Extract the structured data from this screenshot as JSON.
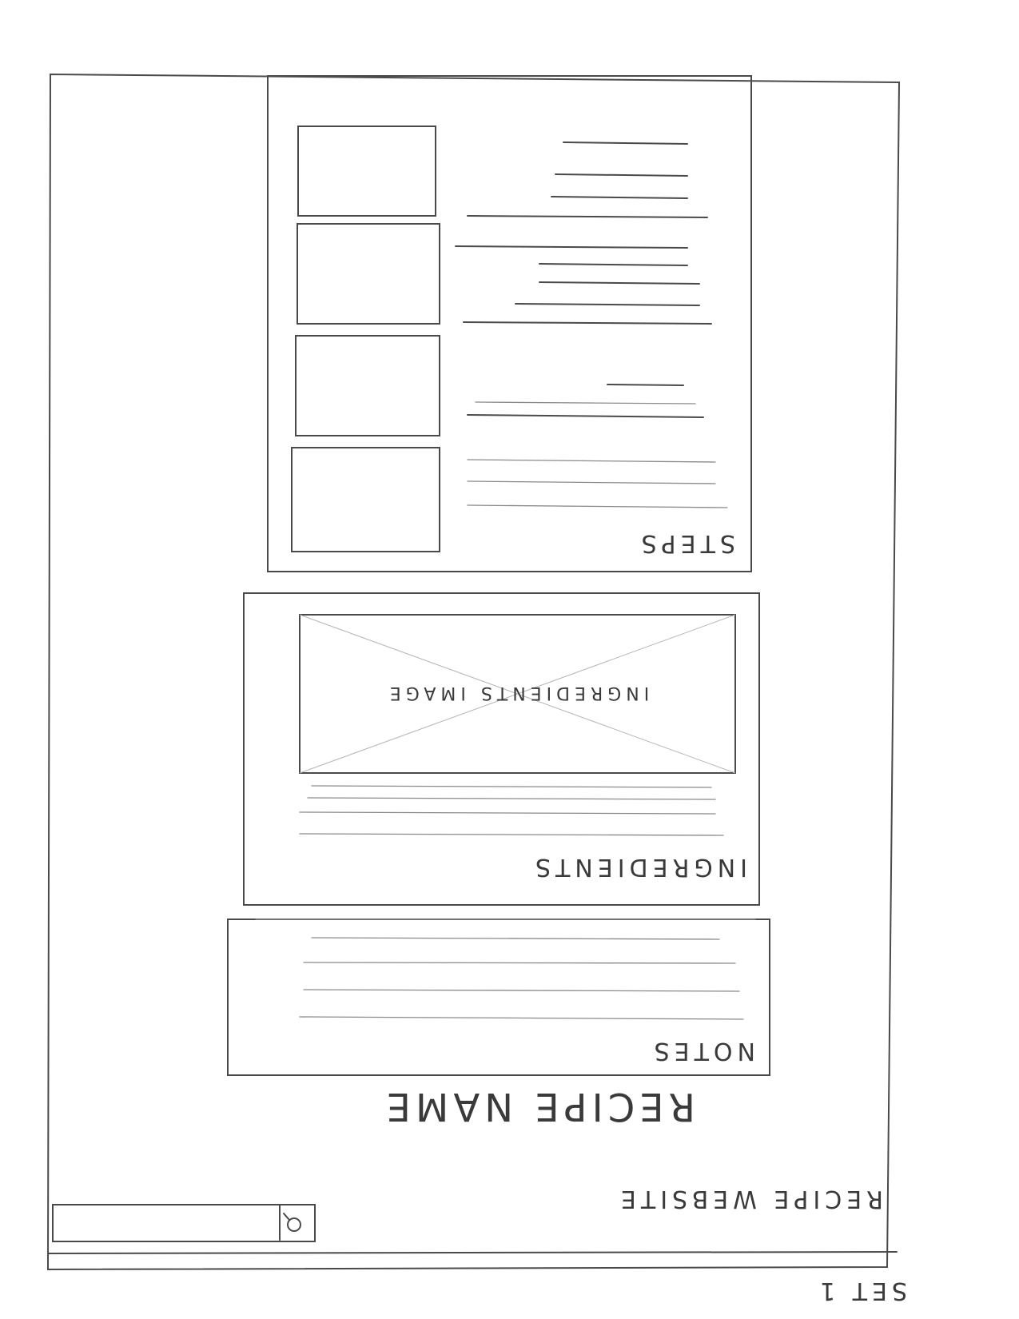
{
  "sheet_label": "SET 1",
  "header": {
    "site_title": "RECIPE WEBSITE",
    "search_icon": "magnifier-icon"
  },
  "recipe": {
    "name": "RECIPE NAME"
  },
  "sections": {
    "notes": {
      "title": "NOTES"
    },
    "ingredients": {
      "title": "INGREDIENTS",
      "image_placeholder": "INGREDIENTS IMAGE"
    },
    "steps": {
      "title": "STEPS"
    }
  },
  "colors": {
    "pencil": "#4a4a4a",
    "paper": "#ffffff"
  }
}
